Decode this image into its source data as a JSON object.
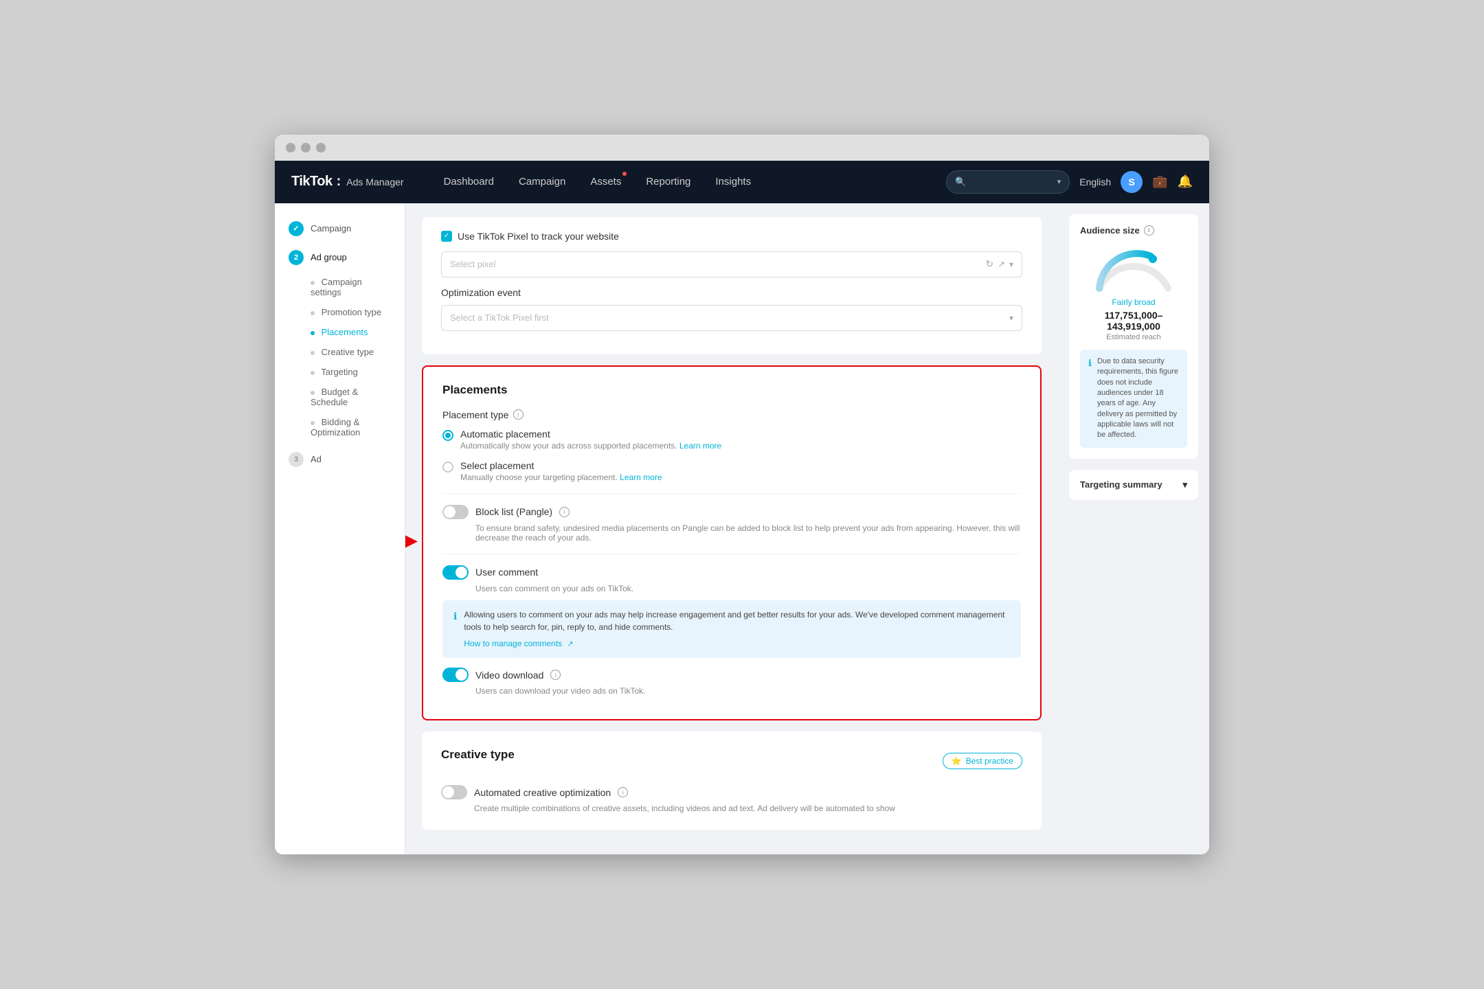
{
  "browser": {
    "dots": [
      "dot1",
      "dot2",
      "dot3"
    ]
  },
  "nav": {
    "logo": "TikTok",
    "logo_colon": ":",
    "logo_sub": "Ads Manager",
    "items": [
      {
        "label": "Dashboard",
        "id": "dashboard",
        "dot": false
      },
      {
        "label": "Campaign",
        "id": "campaign",
        "dot": false
      },
      {
        "label": "Assets",
        "id": "assets",
        "dot": true
      },
      {
        "label": "Reporting",
        "id": "reporting",
        "dot": false
      },
      {
        "label": "Insights",
        "id": "insights",
        "dot": false
      }
    ],
    "search_placeholder": "",
    "language": "English",
    "avatar_initial": "S"
  },
  "sidebar": {
    "step1": {
      "num": "✓",
      "label": "Campaign",
      "state": "done"
    },
    "step2": {
      "num": "2",
      "label": "Ad group",
      "state": "active"
    },
    "sub_items": [
      {
        "label": "Campaign settings",
        "active": false
      },
      {
        "label": "Promotion type",
        "active": false
      },
      {
        "label": "Placements",
        "active": true
      },
      {
        "label": "Creative type",
        "active": false
      },
      {
        "label": "Targeting",
        "active": false
      },
      {
        "label": "Budget & Schedule",
        "active": false
      },
      {
        "label": "Bidding & Optimization",
        "active": false
      }
    ],
    "step3": {
      "num": "3",
      "label": "Ad",
      "state": "inactive"
    }
  },
  "pixel_section": {
    "checkbox_label": "Use TikTok Pixel to track your website",
    "select_placeholder": "Select pixel",
    "opt_label": "Optimization event",
    "opt_placeholder": "Select a TikTok Pixel first"
  },
  "placements": {
    "title": "Placements",
    "placement_type_label": "Placement type",
    "auto_title": "Automatic placement",
    "auto_desc": "Automatically show your ads across supported placements.",
    "auto_link": "Learn more",
    "select_title": "Select placement",
    "select_desc": "Manually choose your targeting placement.",
    "select_link": "Learn more",
    "blocklist_label": "Block list (Pangle)",
    "blocklist_desc": "To ensure brand safety, undesired media placements on Pangle can be added to block list to help prevent your ads from appearing. However, this will decrease the reach of your ads.",
    "user_comment_label": "User comment",
    "user_comment_desc": "Users can comment on your ads on TikTok.",
    "user_comment_info": "Allowing users to comment on your ads may help increase engagement and get better results for your ads. We've developed comment management tools to help search for, pin, reply to, and hide comments.",
    "manage_link": "How to manage comments",
    "video_download_label": "Video download",
    "video_download_desc": "Users can download your video ads on TikTok."
  },
  "creative_type": {
    "title": "Creative type",
    "best_practice": "Best practice",
    "toggle_label": "Automated creative optimization",
    "toggle_desc": "Create multiple combinations of creative assets, including videos and ad text. Ad delivery will be automated to show"
  },
  "audience": {
    "title": "Audience size",
    "gauge_label": "Fairly broad",
    "range": "117,751,000–143,919,000",
    "sub": "Estimated reach",
    "warning": "Due to data security requirements, this figure does not include audiences under 18 years of age. Any delivery as permitted by applicable laws will not be affected."
  },
  "targeting_summary": {
    "title": "Targeting summary",
    "chevron": "▾"
  }
}
